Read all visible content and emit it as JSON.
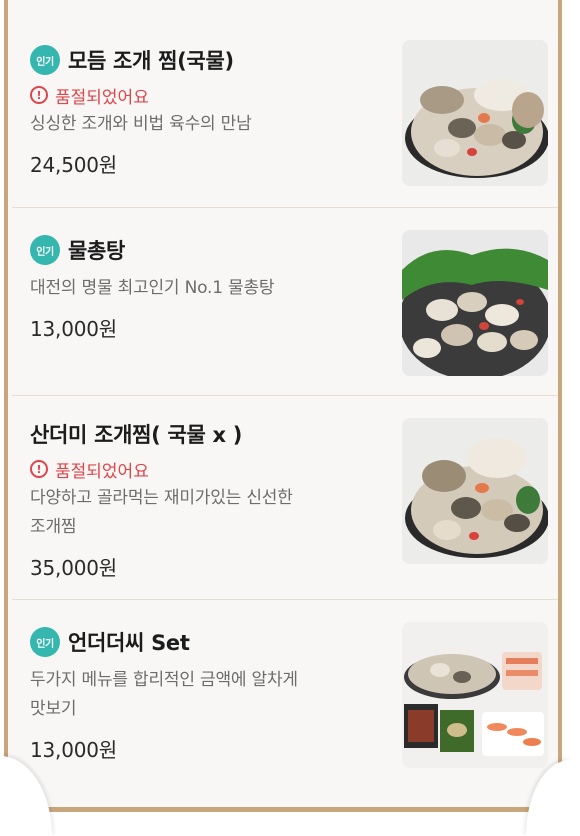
{
  "items": [
    {
      "badge": "인기",
      "name": "모듬 조개 찜(국물)",
      "status": "품절되었어요",
      "desc_lines": [
        "싱싱한 조개와 비법 육수의 만남"
      ],
      "price": "24,500원",
      "image": "clam-steam-pot"
    },
    {
      "badge": "인기",
      "name": "물총탕",
      "status": "",
      "desc_lines": [
        "대전의 명물 최고인기 No.1 물총탕"
      ],
      "price": "13,000원",
      "image": "clam-soup-with-greens"
    },
    {
      "badge": "",
      "name": "산더미 조개찜( 국물 x )",
      "status": "품절되었어요",
      "desc_lines": [
        "다양하고 골라먹는 재미가있는 신선한",
        "조개찜"
      ],
      "price": "35,000원",
      "image": "mountain-clam-steam"
    },
    {
      "badge": "인기",
      "name": "언더더씨 Set",
      "status": "",
      "desc_lines": [
        "두가지 메뉴를 합리적인 금액에 알차게",
        "맛보기"
      ],
      "price": "13,000원",
      "image": "under-the-sea-set-spread"
    }
  ],
  "colors": {
    "badge": "#35b7b0",
    "soldout": "#e0454b",
    "frame": "#c9a57c"
  }
}
